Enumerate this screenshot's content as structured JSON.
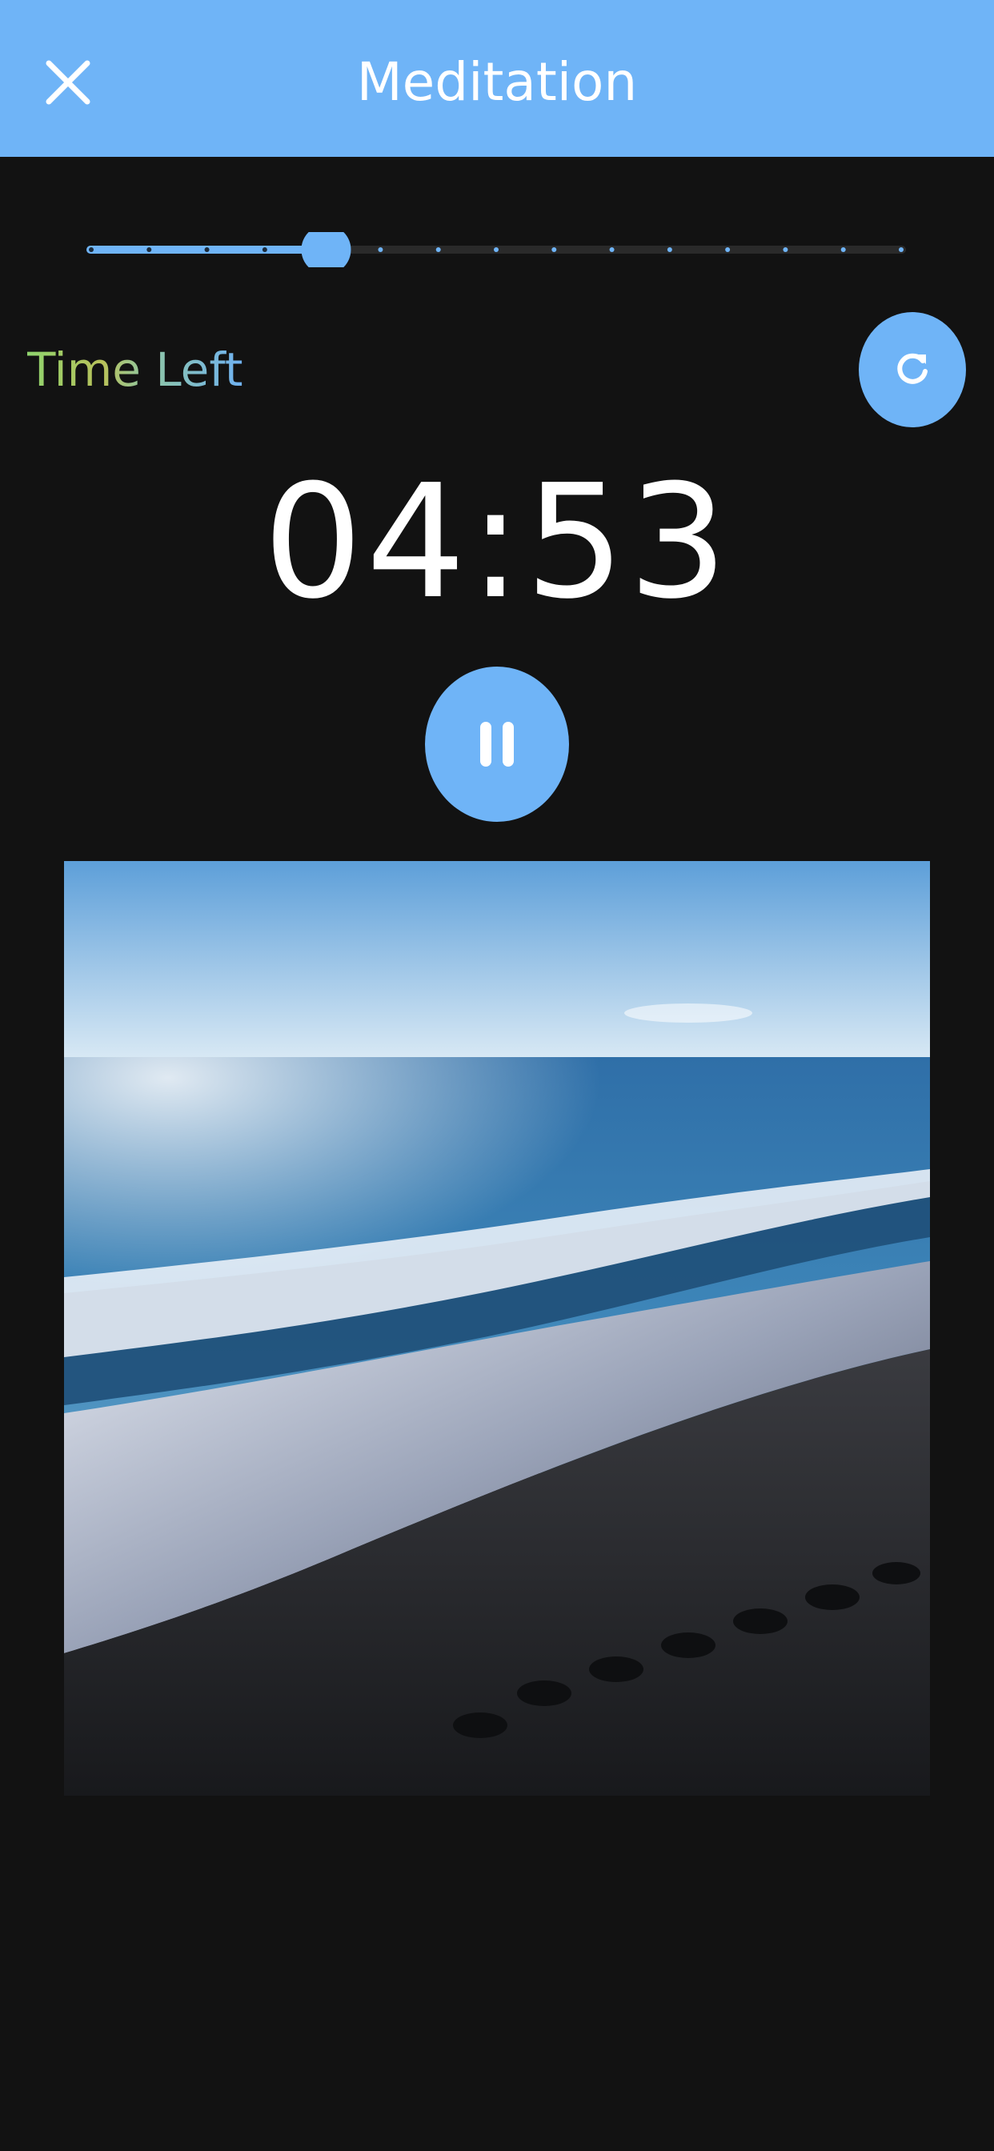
{
  "header": {
    "title": "Meditation",
    "close_icon": "close-icon"
  },
  "session": {
    "time_left_label": "Time Left",
    "timer": "04:53",
    "duration_progress": 0.29,
    "duration_steps": 15,
    "reset_icon": "refresh-icon",
    "pause_icon": "pause-icon"
  },
  "scene": {
    "subject": "ocean waves on a dark pebble beach"
  },
  "colors": {
    "accent": "#6fb4f7",
    "background": "#121212",
    "text": "#ffffff",
    "track": "#2a2a2a"
  }
}
